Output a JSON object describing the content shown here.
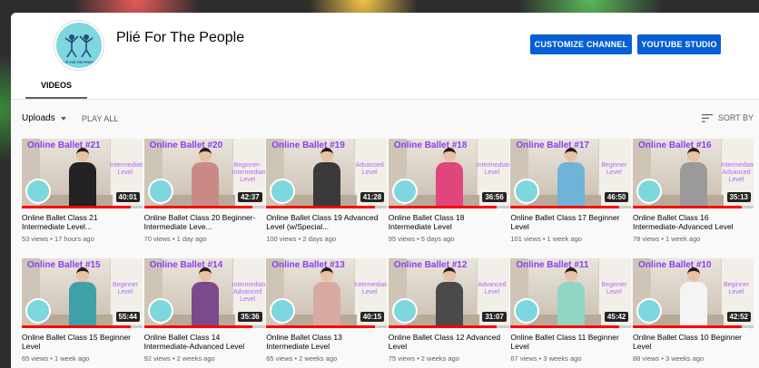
{
  "channel": {
    "name": "Plié For The People",
    "logo_text": "PLIÉ FOR THE PEOPLE"
  },
  "header": {
    "customize_label": "CUSTOMIZE CHANNEL",
    "studio_label": "YOUTUBE STUDIO",
    "tab_videos": "VIDEOS"
  },
  "filters": {
    "uploads_label": "Uploads",
    "play_all_label": "PLAY ALL",
    "sort_label": "SORT BY"
  },
  "colors": {
    "accent": "#065fd4",
    "progress": "#ff0000",
    "overlay_purple": "#8a3ff0"
  },
  "videos": [
    {
      "overlay": "Online Ballet #21",
      "level": "Intermediate Level",
      "duration": "40:01",
      "title": "Online Ballet Class 21 Intermediate Level...",
      "views": "53 views",
      "age": "17 hours ago",
      "shirt": "#222222",
      "watched": 0.9
    },
    {
      "overlay": "Online Ballet #20",
      "level": "Beginner-Intermediate Level",
      "duration": "42:37",
      "title": "Online Ballet Class 20 Beginner-Intermediate Leve...",
      "views": "70 views",
      "age": "1 day ago",
      "shirt": "#c98a86",
      "watched": 0.9
    },
    {
      "overlay": "Online Ballet #19",
      "level": "Advanced Level",
      "duration": "41:28",
      "title": "Online Ballet Class 19 Advanced Level (w/Special...",
      "views": "100 views",
      "age": "2 days ago",
      "shirt": "#3a3a3a",
      "watched": 0.9
    },
    {
      "overlay": "Online Ballet #18",
      "level": "Intermediate Level",
      "duration": "36:56",
      "title": "Online Ballet Class 18 Intermediate Level",
      "views": "95 views",
      "age": "5 days ago",
      "shirt": "#e0457b",
      "watched": 0.9
    },
    {
      "overlay": "Online Ballet #17",
      "level": "Beginner Level",
      "duration": "46:50",
      "title": "Online Ballet Class 17 Beginner Level",
      "views": "101 views",
      "age": "1 week ago",
      "shirt": "#6fb3d9",
      "watched": 0.9
    },
    {
      "overlay": "Online Ballet #16",
      "level": "Intermediate-Advanced Level",
      "duration": "35:13",
      "title": "Online Ballet Class 16 Intermediate-Advanced Level",
      "views": "78 views",
      "age": "1 week ago",
      "shirt": "#9a9a9a",
      "watched": 0.9
    },
    {
      "overlay": "Online Ballet #15",
      "level": "Beginner Level",
      "duration": "55:44",
      "title": "Online Ballet Class 15 Beginner Level",
      "views": "65 views",
      "age": "1 week ago",
      "shirt": "#3fa0a8",
      "watched": 0.9
    },
    {
      "overlay": "Online Ballet #14",
      "level": "Intermediate-Advanced Level",
      "duration": "35:36",
      "title": "Online Ballet Class 14 Intermediate-Advanced Level",
      "views": "92 views",
      "age": "2 weeks ago",
      "shirt": "#7a4a8a",
      "watched": 0.9
    },
    {
      "overlay": "Online Ballet #13",
      "level": "Intermediate Level",
      "duration": "40:15",
      "title": "Online Ballet Class 13 Intermediate Level",
      "views": "65 views",
      "age": "2 weeks ago",
      "shirt": "#d9a9a3",
      "watched": 0.9
    },
    {
      "overlay": "Online Ballet #12",
      "level": "Advanced Level",
      "duration": "31:07",
      "title": "Online Ballet Class 12 Advanced Level",
      "views": "75 views",
      "age": "2 weeks ago",
      "shirt": "#4a4a4a",
      "watched": 0.9
    },
    {
      "overlay": "Online Ballet #11",
      "level": "Beginner Level",
      "duration": "45:42",
      "title": "Online Ballet Class 11 Beginner Level",
      "views": "67 views",
      "age": "3 weeks ago",
      "shirt": "#8fd6c4",
      "watched": 0.9
    },
    {
      "overlay": "Online Ballet #10",
      "level": "Beginner Level",
      "duration": "42:52",
      "title": "Online Ballet Class 10 Beginner Level",
      "views": "88 views",
      "age": "3 weeks ago",
      "shirt": "#f4f4f4",
      "watched": 0.9
    }
  ]
}
